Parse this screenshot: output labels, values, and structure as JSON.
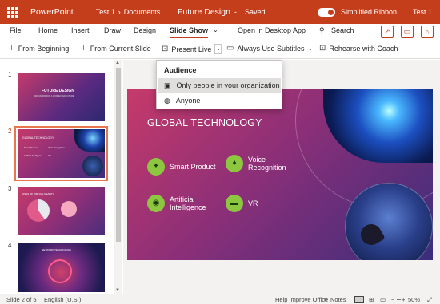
{
  "titlebar": {
    "app_name": "PowerPoint",
    "breadcrumb_parent": "Test 1",
    "breadcrumb_sep": "›",
    "breadcrumb_folder": "Documents",
    "doc_title": "Future Design",
    "doc_sep": "-",
    "save_status": "Saved",
    "toggle_label": "Simplified Ribbon",
    "user": "Test 1"
  },
  "menu": {
    "tabs": [
      "File",
      "Home",
      "Insert",
      "Draw",
      "Design",
      "Slide Show"
    ],
    "more": "⌄",
    "open_desktop": "Open in Desktop App",
    "search": "Search"
  },
  "ribbon": {
    "from_beginning": "From Beginning",
    "from_current": "From Current Slide",
    "present_live": "Present Live",
    "subtitles": "Always Use Subtitles",
    "rehearse": "Rehearse with Coach"
  },
  "dropdown": {
    "heading": "Audience",
    "items": [
      "Only people in your organization",
      "Anyone"
    ]
  },
  "slides": {
    "numbers": [
      "1",
      "2",
      "3",
      "4"
    ],
    "thumb1": {
      "title": "FUTURE DESIGN",
      "subtitle": "INNOVATION FOR A CONNECTED FUTURE"
    },
    "thumb2": {
      "title": "GLOBAL TECHNOLOGY",
      "items": [
        "Smart Product",
        "Voice Recognition",
        "Artificial Intelligence",
        "VR"
      ]
    },
    "thumb3": {
      "title": "USES OF VIRTUAL REALITY"
    },
    "thumb4": {
      "title": "NETWORK TECHNOLOGY"
    }
  },
  "slide": {
    "title": "GLOBAL TECHNOLOGY",
    "features": [
      {
        "label": "Smart Product",
        "icon": "lightbulb-icon"
      },
      {
        "label": "Voice\nRecognition",
        "icon": "microphone-icon"
      },
      {
        "label": "Artificial\nIntelligence",
        "icon": "head-icon"
      },
      {
        "label": "VR",
        "icon": "vr-headset-icon"
      }
    ]
  },
  "status": {
    "slide_pos": "Slide 2 of 5",
    "language": "English (U.S.)",
    "help": "Help Improve Office",
    "notes": "Notes",
    "zoom": "50%",
    "zoom_minus": "−",
    "zoom_plus": "+"
  },
  "colors": {
    "accent": "#c43e1c",
    "feature_green": "#8dc63f"
  }
}
